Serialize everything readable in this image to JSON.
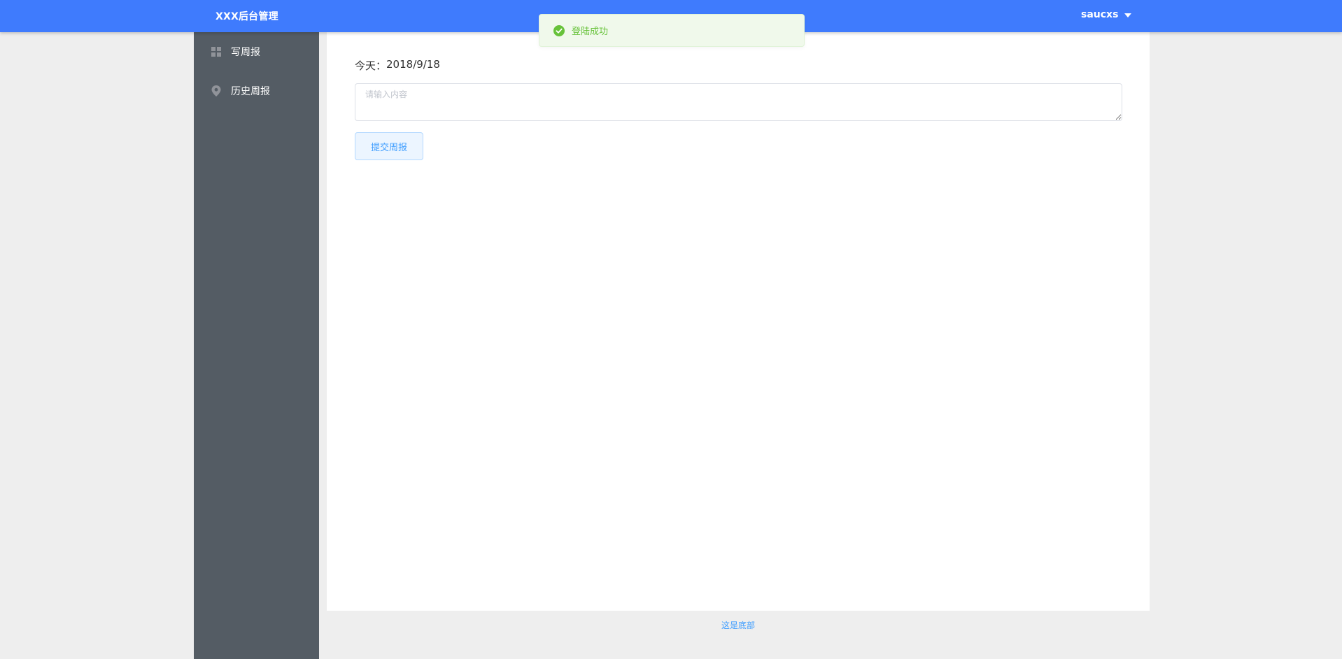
{
  "header": {
    "brand": "XXX后台管理",
    "user": "saucxs"
  },
  "sidebar": {
    "items": [
      {
        "label": "写周报",
        "icon": "grid-icon"
      },
      {
        "label": "历史周报",
        "icon": "location-pin-icon"
      }
    ]
  },
  "main": {
    "today_label": "今天：",
    "today_value": "2018/9/18",
    "textarea_placeholder": "请输入内容",
    "textarea_value": "",
    "submit_label": "提交周报"
  },
  "footer": {
    "text": "这是底部"
  },
  "toast": {
    "message": "登陆成功",
    "type": "success"
  },
  "colors": {
    "header_bg": "#3f7bfd",
    "sidebar_bg": "#545c64",
    "success": "#67c23a",
    "primary": "#409eff"
  }
}
